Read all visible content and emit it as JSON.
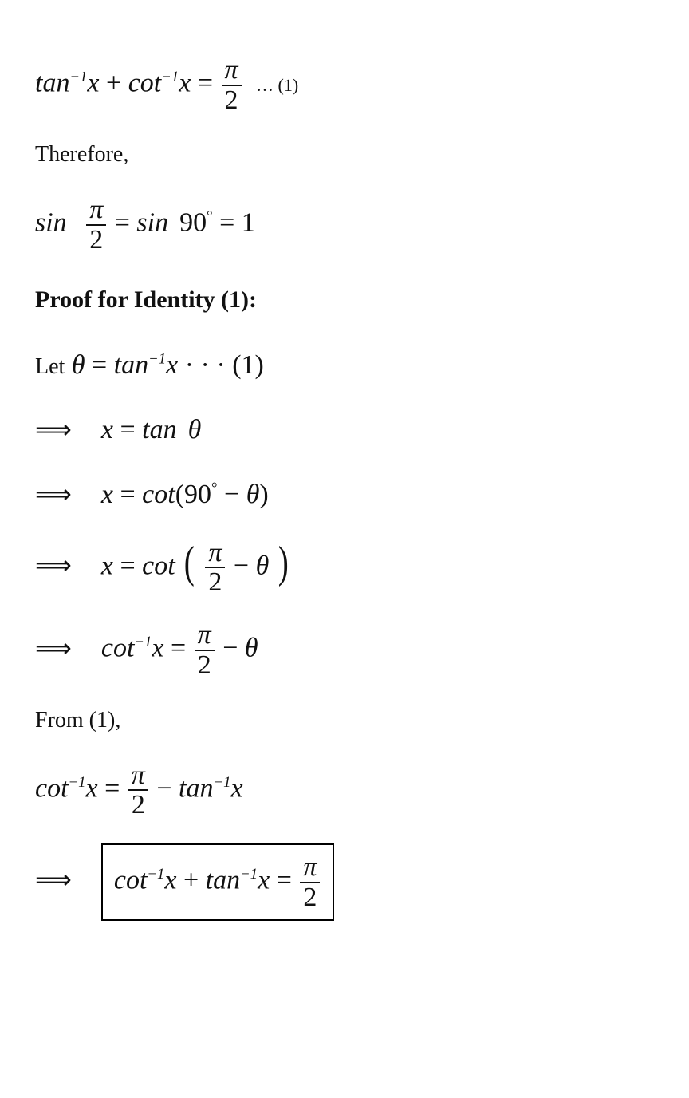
{
  "line1": {
    "tan": "tan",
    "sup": "−1",
    "x": "x",
    "plus": "+",
    "cot": "cot",
    "eq": "=",
    "pi": "π",
    "two": "2",
    "dots": "…",
    "ref": "(1)"
  },
  "therefore": "Therefore,",
  "line2": {
    "sin": "sin",
    "pi": "π",
    "two": "2",
    "eq": "=",
    "ninety": "90",
    "one": "1",
    "deg": "°"
  },
  "proof": "Proof for Identity (1):",
  "let": "Let",
  "theta": "θ",
  "tan": "tan",
  "sup": "−1",
  "x": "x",
  "dots3": "· · ·",
  "ref1": "(1)",
  "imp": "⟹",
  "cot": "cot",
  "eq": "=",
  "ninetyd": "90",
  "deg": "°",
  "minus": "−",
  "pi": "π",
  "two": "2",
  "plus": "+",
  "from": "From (1),",
  "chart_data": null
}
